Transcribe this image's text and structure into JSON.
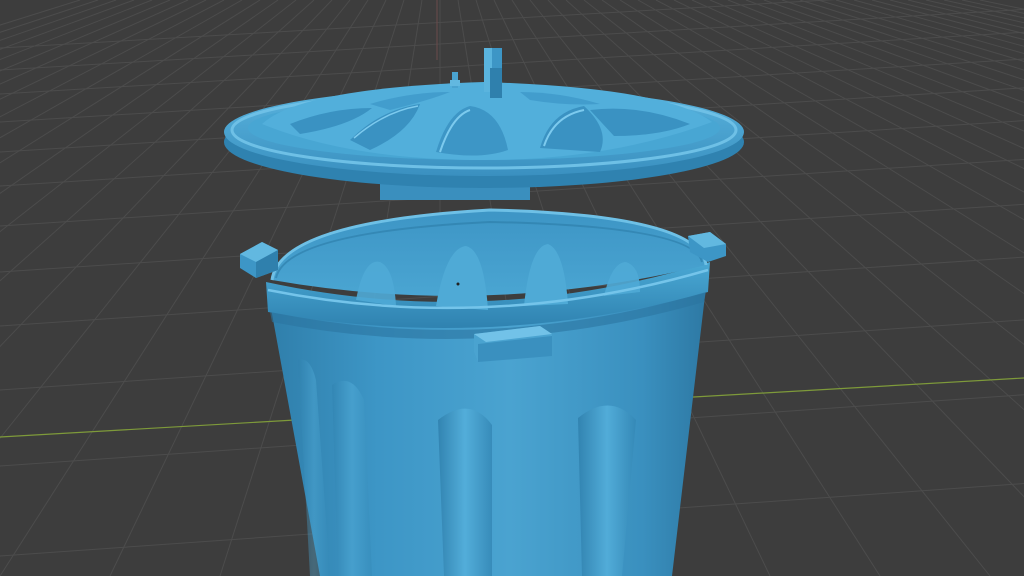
{
  "viewport": {
    "background_color": "#3d3d3d",
    "grid_line_color": "#4c4c4c",
    "x_axis_color": "#7e9a3a",
    "z_axis_color": "#a04040",
    "object_color": "#3d96c6",
    "object_shadow_color": "#2a6f96",
    "object_highlight_color": "#6ec0e6"
  },
  "scene": {
    "object_name": "trash-can",
    "parts": [
      "trash-can-lid",
      "trash-can-body",
      "lid-handle",
      "body-handles"
    ]
  }
}
